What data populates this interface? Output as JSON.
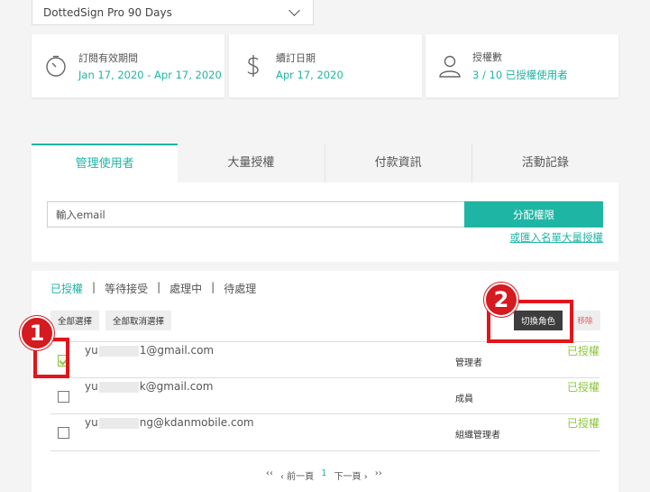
{
  "plan": {
    "selected": "DottedSign Pro 90 Days"
  },
  "cards": [
    {
      "icon": "timer-icon",
      "label": "訂閱有效期間",
      "value": "Jan 17, 2020 - Apr 17, 2020"
    },
    {
      "icon": "dollar-icon",
      "label": "續訂日期",
      "value": "Apr 17, 2020"
    },
    {
      "icon": "user-icon",
      "label": "授權數",
      "value": "3 / 10 已授權使用者"
    }
  ],
  "tabs": [
    {
      "label": "管理使用者",
      "active": true
    },
    {
      "label": "大量授權"
    },
    {
      "label": "付款資訊"
    },
    {
      "label": "活動記錄"
    }
  ],
  "assign": {
    "placeholder": "輸入email",
    "button": "分配權限",
    "import_link": "或匯入名單大量授權"
  },
  "filters": {
    "authorized": "已授權",
    "pending": "等待接受",
    "processing": "處理中",
    "to_process": "待處理",
    "separator": "|"
  },
  "actions": {
    "select_all": "全部選擇",
    "deselect_all": "全部取消選擇",
    "switch_role": "切換角色",
    "remove": "移除"
  },
  "users": [
    {
      "email_prefix": "yu",
      "email_suffix": "1@gmail.com",
      "role": "管理者",
      "status": "已授權",
      "checked": true
    },
    {
      "email_prefix": "yu",
      "email_suffix": "k@gmail.com",
      "role": "成員",
      "status": "已授權",
      "checked": false
    },
    {
      "email_prefix": "yu",
      "email_suffix": "ng@kdanmobile.com",
      "role": "組織管理者",
      "status": "已授權",
      "checked": false
    }
  ],
  "pager": {
    "first": "‹‹",
    "prev": "‹ 前一頁",
    "current": "1",
    "next": "下一頁 ›",
    "last": "››"
  },
  "annotations": {
    "one": "1",
    "two": "2"
  },
  "colors": {
    "accent": "#1fb5a4",
    "status_green": "#8dc63f",
    "annotation_red": "#e3141c"
  }
}
